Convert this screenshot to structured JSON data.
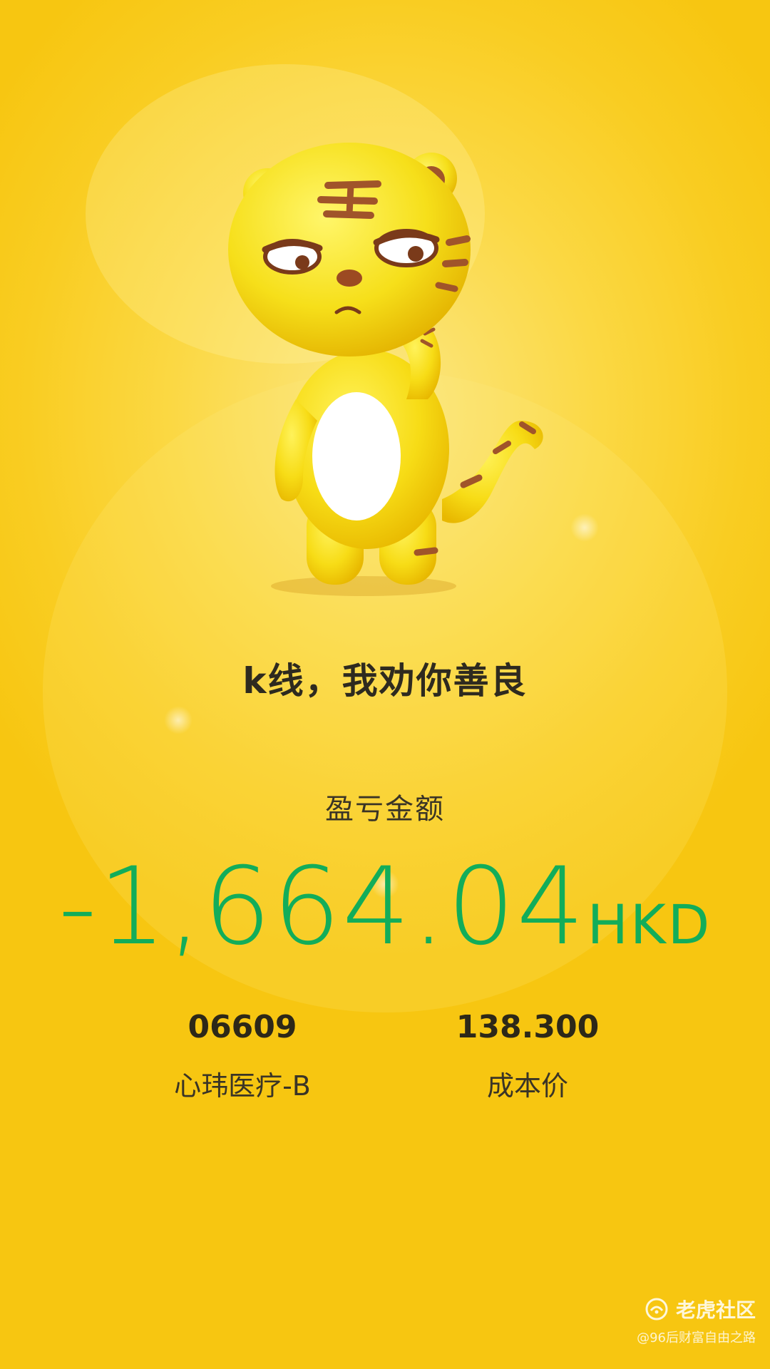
{
  "slogan": "k线，我劝你善良",
  "pnl": {
    "label": "盈亏金额",
    "amount": "-1,664.04",
    "currency": "HKD",
    "color": "#12ad5a"
  },
  "stock": {
    "code": "06609",
    "name": "心玮医疗-B"
  },
  "cost": {
    "value": "138.300",
    "label": "成本价"
  },
  "watermark": {
    "brand": "老虎社区",
    "handle": "@96后财富自由之路",
    "icon": "tiger-logo-icon"
  },
  "colors": {
    "background": "#f9cd22",
    "text": "#2e2a1f",
    "loss": "#12ad5a"
  }
}
